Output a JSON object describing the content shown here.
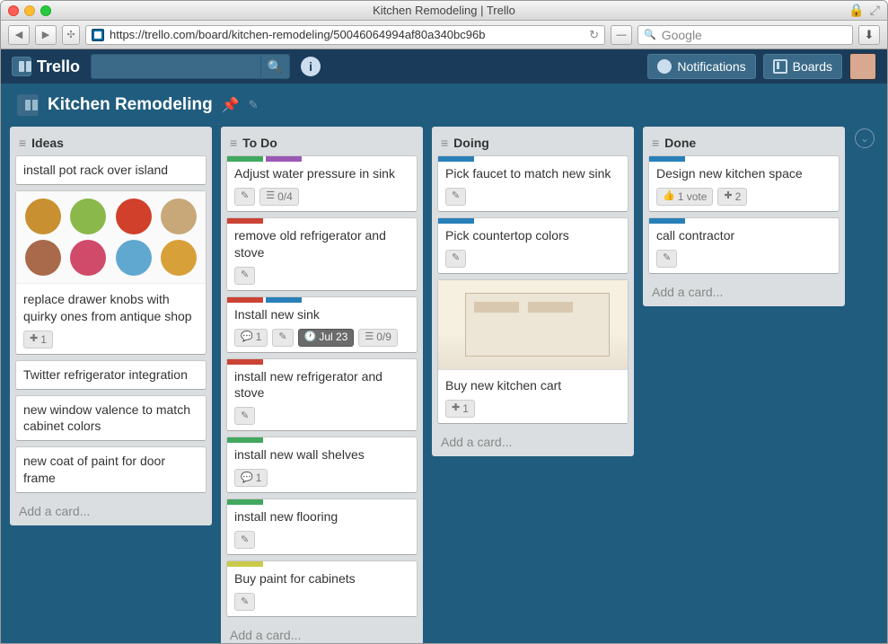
{
  "browser": {
    "title": "Kitchen Remodeling | Trello",
    "url": "https://trello.com/board/kitchen-remodeling/50046064994af80a340bc96b",
    "search_placeholder": "Google"
  },
  "header": {
    "logo": "Trello",
    "notifications": "Notifications",
    "boards": "Boards"
  },
  "board": {
    "title": "Kitchen Remodeling"
  },
  "lists": [
    {
      "title": "Ideas",
      "add": "Add a card...",
      "cards": [
        {
          "text": "install pot rack over island"
        },
        {
          "text": "replace drawer knobs with quirky ones from antique shop",
          "knobs": true,
          "badges": [
            {
              "icon": "plus",
              "text": "1"
            }
          ]
        },
        {
          "text": "Twitter refrigerator integration"
        },
        {
          "text": "new window valence to match cabinet colors"
        },
        {
          "text": "new coat of paint for door frame"
        }
      ]
    },
    {
      "title": "To Do",
      "add": "Add a card...",
      "cards": [
        {
          "labels": [
            "green",
            "purple"
          ],
          "text": "Adjust water pressure in sink",
          "badges": [
            {
              "icon": "pencil"
            },
            {
              "icon": "check",
              "text": "0/4"
            }
          ]
        },
        {
          "labels": [
            "red"
          ],
          "text": "remove old refrigerator and stove",
          "badges": [
            {
              "icon": "pencil"
            }
          ]
        },
        {
          "labels": [
            "red",
            "blue"
          ],
          "text": "Install new sink",
          "badges": [
            {
              "icon": "comment",
              "text": "1"
            },
            {
              "icon": "pencil"
            },
            {
              "icon": "clock",
              "text": "Jul 23",
              "dark": true
            },
            {
              "icon": "check",
              "text": "0/9"
            }
          ]
        },
        {
          "labels": [
            "red"
          ],
          "text": "install new refrigerator and stove",
          "badges": [
            {
              "icon": "pencil"
            }
          ]
        },
        {
          "labels": [
            "green"
          ],
          "text": "install new wall shelves",
          "badges": [
            {
              "icon": "comment",
              "text": "1"
            }
          ]
        },
        {
          "labels": [
            "green"
          ],
          "text": "install new flooring",
          "badges": [
            {
              "icon": "pencil"
            }
          ]
        },
        {
          "labels": [
            "yellow"
          ],
          "text": "Buy paint for cabinets",
          "badges": [
            {
              "icon": "pencil"
            }
          ]
        }
      ]
    },
    {
      "title": "Doing",
      "add": "Add a card...",
      "cards": [
        {
          "labels": [
            "blue"
          ],
          "text": "Pick faucet to match new sink",
          "badges": [
            {
              "icon": "pencil"
            }
          ]
        },
        {
          "labels": [
            "blue"
          ],
          "text": "Pick countertop colors",
          "badges": [
            {
              "icon": "pencil"
            }
          ]
        },
        {
          "text": "Buy new kitchen cart",
          "cart": true,
          "badges": [
            {
              "icon": "plus",
              "text": "1"
            }
          ]
        }
      ]
    },
    {
      "title": "Done",
      "add": "Add a card...",
      "cards": [
        {
          "labels": [
            "blue"
          ],
          "text": "Design new kitchen space",
          "badges": [
            {
              "icon": "thumb",
              "text": "1 vote"
            },
            {
              "icon": "plus",
              "text": "2"
            }
          ]
        },
        {
          "labels": [
            "blue"
          ],
          "text": "call contractor",
          "badges": [
            {
              "icon": "pencil"
            }
          ]
        }
      ]
    }
  ]
}
